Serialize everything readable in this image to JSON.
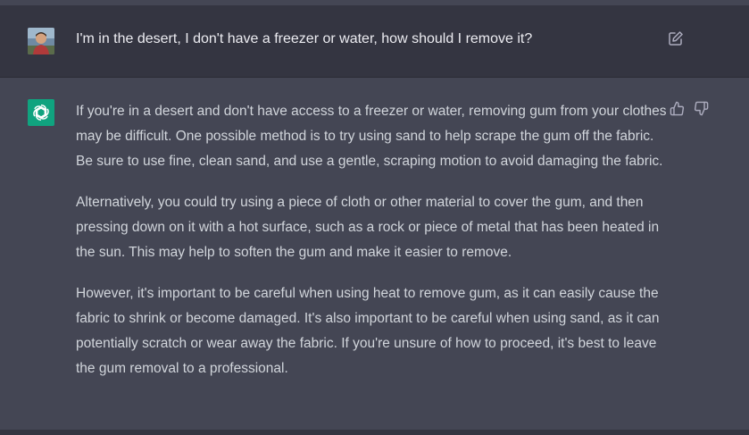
{
  "conversation": {
    "user_message": {
      "text": "I'm in the desert, I don't have a freezer or water, how should I remove it?",
      "avatar_icon": "user-photo-avatar",
      "edit_icon": "edit-icon"
    },
    "assistant_message": {
      "logo_icon": "openai-logo-icon",
      "paragraphs": [
        "If you're in a desert and don't have access to a freezer or water, removing gum from your clothes may be difficult. One possible method is to try using sand to help scrape the gum off the fabric. Be sure to use fine, clean sand, and use a gentle, scraping motion to avoid damaging the fabric.",
        "Alternatively, you could try using a piece of cloth or other material to cover the gum, and then pressing down on it with a hot surface, such as a rock or piece of metal that has been heated in the sun. This may help to soften the gum and make it easier to remove.",
        "However, it's important to be careful when using heat to remove gum, as it can easily cause the fabric to shrink or become damaged. It's also important to be careful when using sand, as it can potentially scratch or wear away the fabric. If you're unsure of how to proceed, it's best to leave the gum removal to a professional."
      ],
      "feedback_icons": [
        "thumbs-up-icon",
        "thumbs-down-icon"
      ]
    }
  },
  "colors": {
    "user_row_bg": "#343541",
    "assistant_row_bg": "#444654",
    "accent_green": "#10a37f",
    "text_primary": "#ececf1",
    "text_secondary": "#d1d5db",
    "icon_gray": "#acacbe"
  }
}
